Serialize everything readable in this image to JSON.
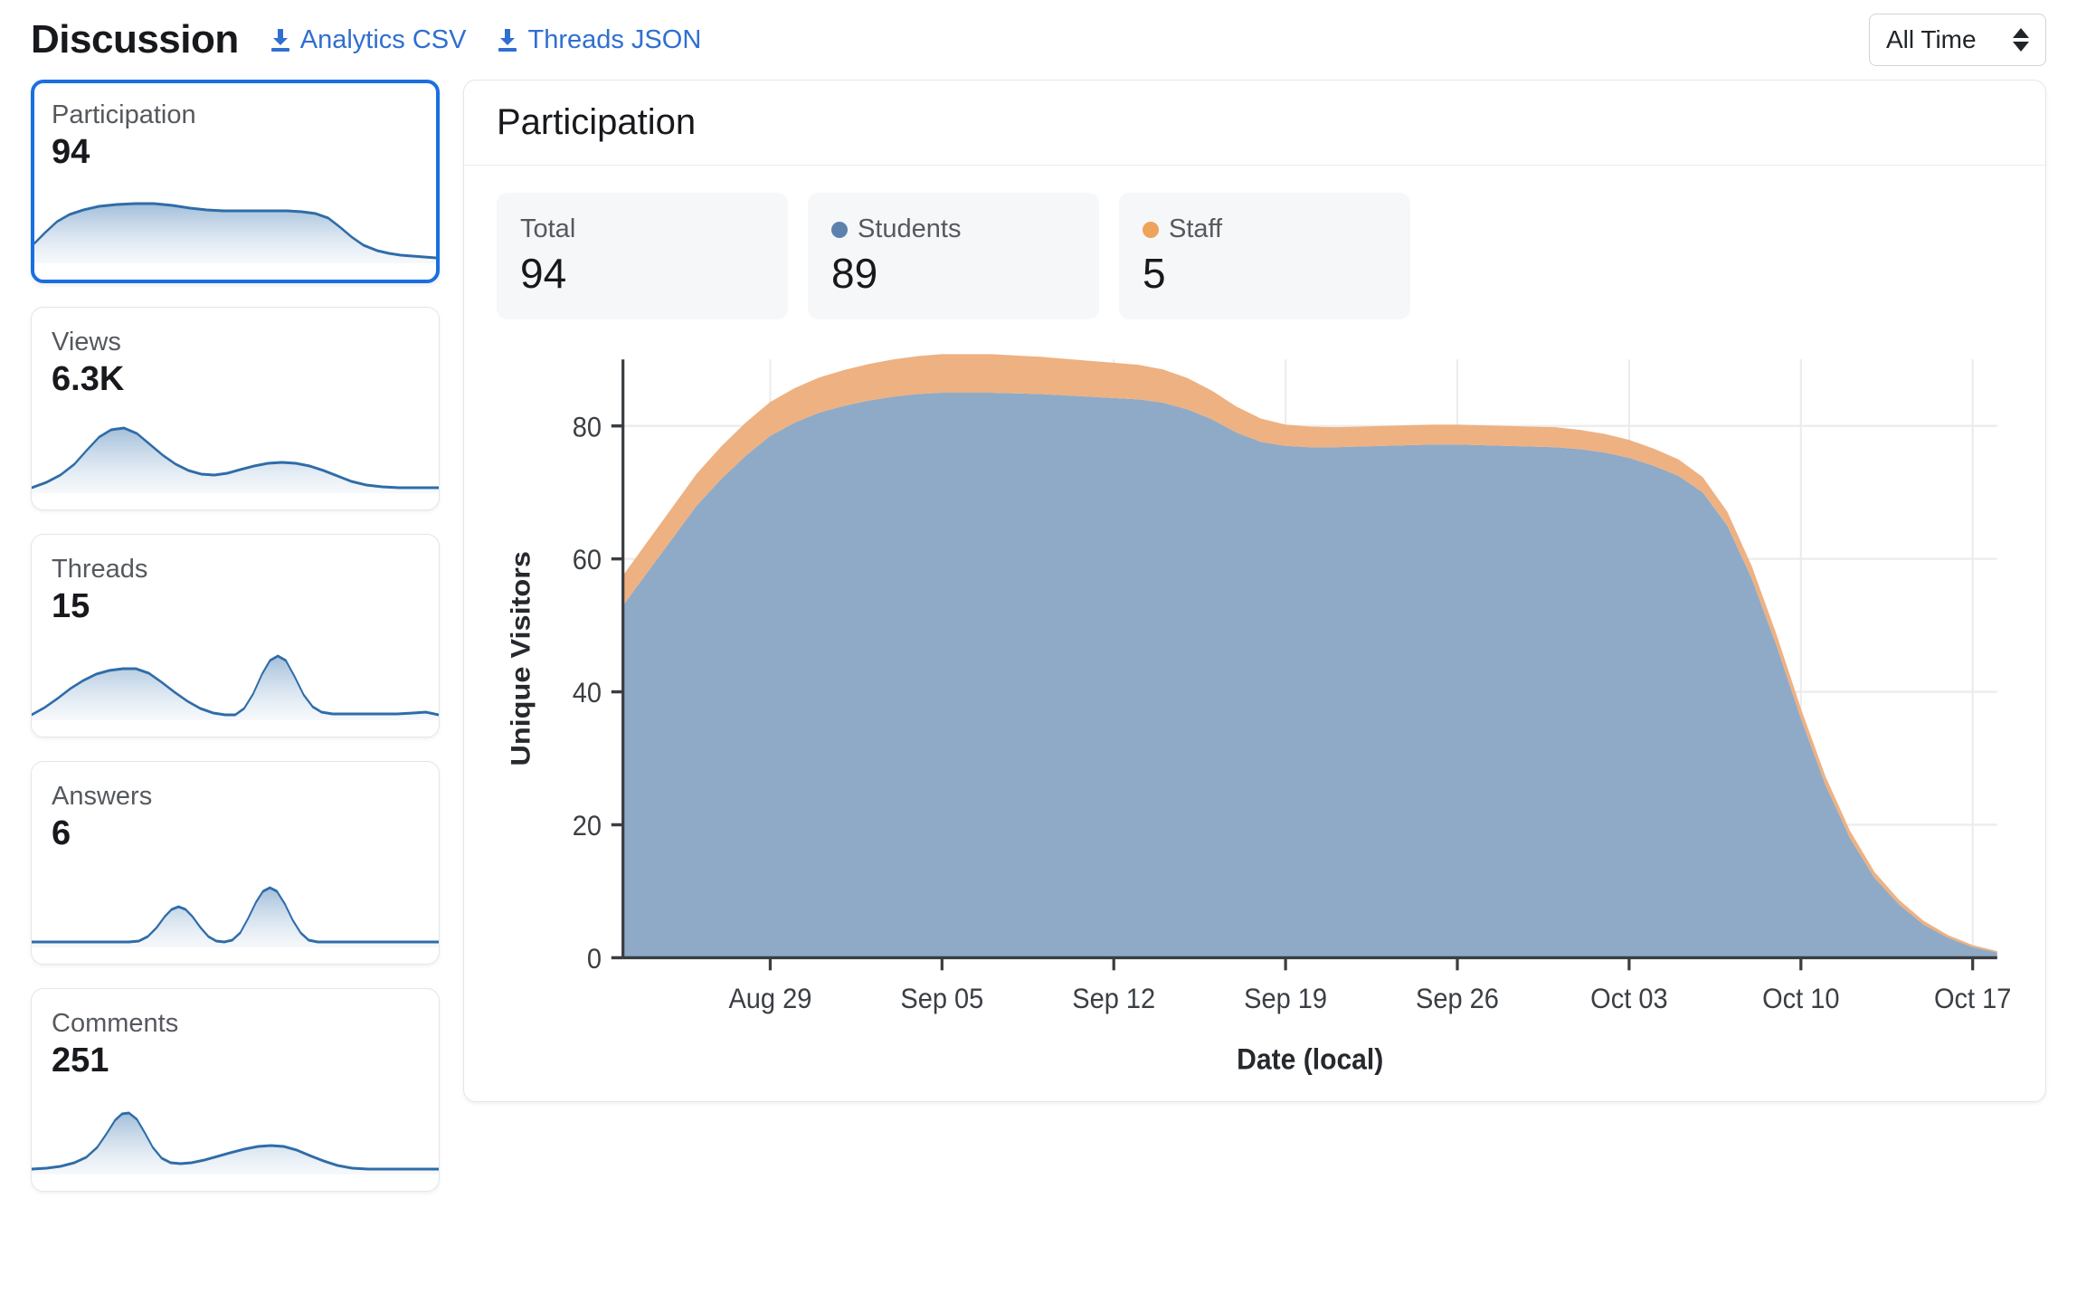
{
  "header": {
    "title": "Discussion",
    "links": [
      {
        "label": "Analytics CSV",
        "icon": "download-icon"
      },
      {
        "label": "Threads JSON",
        "icon": "download-icon"
      }
    ],
    "range_select": {
      "value": "All Time",
      "icon": "select-arrows-icon"
    }
  },
  "sidebar": {
    "items": [
      {
        "label": "Participation",
        "value": "94",
        "selected": true,
        "spark": "0,70 22,58 46,46 72,38 100,33 132,29 168,27 206,26 244,26 282,28 318,31 352,33 386,34 420,34 452,34 484,34 516,34 546,35 574,37 600,42 624,52 648,63 672,72 700,78 724,81 748,83 772,84 796,85 820,86"
      },
      {
        "label": "Views",
        "value": "6.3K",
        "selected": false,
        "spark": "0,86 30,80 58,72 86,60 112,44 136,30 160,22 186,20 212,26 238,38 264,50 290,60 316,67 342,71 368,72 394,70 420,66 448,62 476,59 504,58 532,59 560,62 588,67 616,73 644,79 674,83 706,85 740,86 778,86 820,86"
      },
      {
        "label": "Threads",
        "value": "15",
        "selected": false,
        "spark": "0,86 26,78 52,68 78,57 104,48 130,41 156,37 184,35 210,35 236,40 262,50 288,61 314,71 340,79 366,84 390,86 410,86 428,79 446,63 464,41 480,26 496,21 512,26 530,44 548,64 566,77 584,83 606,85 634,85 668,85 702,85 736,85 768,84 794,83 820,86"
      },
      {
        "label": "Answers",
        "value": "6",
        "selected": false,
        "spark": "0,86 40,86 80,86 120,86 160,86 196,86 216,85 234,80 252,70 268,58 282,50 296,47 310,50 324,58 340,70 356,80 372,85 388,86 404,84 420,76 436,60 452,42 466,30 480,26 494,30 510,44 526,62 542,76 558,84 576,86 620,86 680,86 740,86 780,86 820,86"
      },
      {
        "label": "Comments",
        "value": "251",
        "selected": false,
        "spark": "0,86 30,85 58,83 86,79 110,73 132,62 152,46 168,32 182,25 196,24 212,31 228,46 244,62 262,74 280,79 300,80 322,79 348,76 374,72 400,68 428,64 456,61 482,60 508,61 534,65 560,71 588,77 616,82 646,85 678,86 716,86 760,86 820,86"
      }
    ]
  },
  "main": {
    "title": "Participation",
    "stats": [
      {
        "label": "Total",
        "value": "94",
        "dot": null
      },
      {
        "label": "Students",
        "value": "89",
        "dot": "#5b82ad"
      },
      {
        "label": "Staff",
        "value": "5",
        "dot": "#eda35a"
      }
    ]
  },
  "chart_data": {
    "type": "area",
    "stacked": true,
    "title": "Participation",
    "xlabel": "Date (local)",
    "ylabel": "Unique Visitors",
    "ylim": [
      0,
      90
    ],
    "yticks": [
      0,
      20,
      40,
      60,
      80
    ],
    "grid": true,
    "legend_position": "top",
    "x_tick_labels": [
      "Aug 29",
      "Sep 05",
      "Sep 12",
      "Sep 19",
      "Sep 26",
      "Oct 03",
      "Oct 10",
      "Oct 17"
    ],
    "x_tick_index": [
      6,
      13,
      20,
      27,
      34,
      41,
      48,
      55
    ],
    "x": [
      0,
      1,
      2,
      3,
      4,
      5,
      6,
      7,
      8,
      9,
      10,
      11,
      12,
      13,
      14,
      15,
      16,
      17,
      18,
      19,
      20,
      21,
      22,
      23,
      24,
      25,
      26,
      27,
      28,
      29,
      30,
      31,
      32,
      33,
      34,
      35,
      36,
      37,
      38,
      39,
      40,
      41,
      42,
      43,
      44,
      45,
      46,
      47,
      48,
      49,
      50,
      51,
      52,
      53,
      54,
      55,
      56
    ],
    "series": [
      {
        "name": "Students",
        "color": "#8faac6",
        "values": [
          53,
          58,
          63,
          68,
          72,
          75.5,
          78.5,
          80.5,
          82,
          83,
          83.8,
          84.4,
          84.8,
          85,
          85,
          85,
          84.9,
          84.8,
          84.6,
          84.4,
          84.2,
          84,
          83.5,
          82.5,
          81,
          79,
          77.6,
          77,
          76.8,
          76.8,
          76.9,
          77,
          77.1,
          77.2,
          77.2,
          77.1,
          77,
          76.9,
          76.8,
          76.5,
          76,
          75.2,
          74,
          72.5,
          70,
          65,
          57,
          47,
          36,
          26,
          18,
          12,
          8,
          5,
          3,
          1.6,
          0.8
        ]
      },
      {
        "name": "Staff",
        "color": "#eeb182",
        "values": [
          4.5,
          4.6,
          4.7,
          4.8,
          4.9,
          5,
          5.1,
          5.2,
          5.3,
          5.4,
          5.5,
          5.6,
          5.7,
          5.8,
          5.8,
          5.8,
          5.7,
          5.6,
          5.5,
          5.4,
          5.3,
          5.2,
          5,
          4.7,
          4.3,
          3.9,
          3.5,
          3.2,
          3.1,
          3,
          3,
          3,
          3,
          3,
          3,
          3,
          3,
          3,
          3,
          2.9,
          2.8,
          2.7,
          2.6,
          2.5,
          2.3,
          2.1,
          1.9,
          1.7,
          1.5,
          1.3,
          1.1,
          0.9,
          0.7,
          0.55,
          0.4,
          0.3,
          0.2
        ]
      }
    ]
  }
}
